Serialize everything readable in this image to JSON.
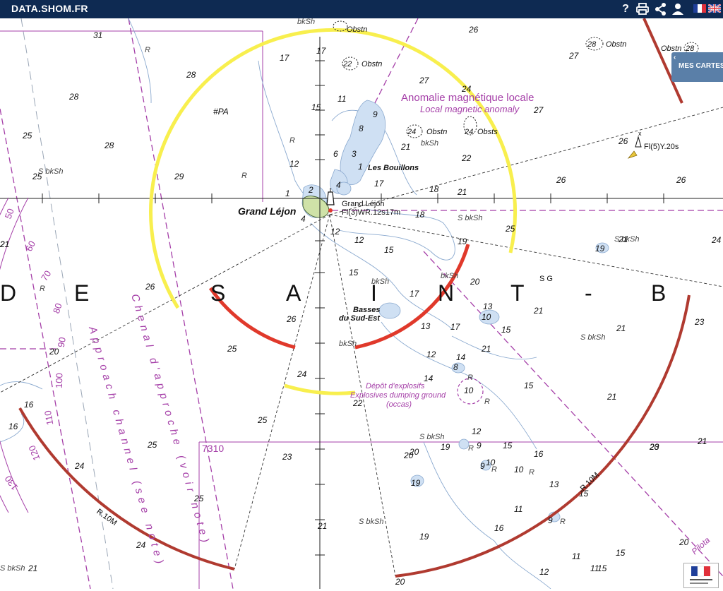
{
  "topbar": {
    "brand": "DATA.SHOM.FR",
    "help": "?"
  },
  "icons": {
    "help": "help-icon",
    "print": "print-icon",
    "share": "share-icon",
    "user": "user-icon",
    "lang_fr": "french-flag-icon",
    "lang_en": "uk-flag-icon"
  },
  "panel": {
    "chevron": "‹",
    "label": "MES CARTES"
  },
  "colors": {
    "topbar": "#0e2a52",
    "sea": "#ffffff",
    "shallow": "#cfe0f3",
    "depth_contour": "#8aa9cf",
    "magenta": "#a53fa8",
    "sector_yellow": "#f8ef4e",
    "sector_red": "#e0392b",
    "range_arc": "#b03a30",
    "land": "#cfe2a8"
  },
  "chart": {
    "big_letters": [
      "D",
      "E",
      "S",
      "A",
      "I",
      "N",
      "T",
      "-",
      "B"
    ],
    "labels": {
      "anomaly_fr": "Anomalie magnétique locale",
      "anomaly_en": "Local magnetic anomaly",
      "les_bouillons": "Les Bouillons",
      "grand_lejon_big": "Grand Léjon",
      "grand_lejon_small": "Grand Léjon",
      "light_char": "Fl(3)WR.12s17m",
      "buoy_char": "Fl(5)Y.20s",
      "basses_1": "Basses",
      "basses_2": "du Sud-Est",
      "depot_1": "Dépôt d'explosifs",
      "depot_2": "Explosives dumping ground",
      "depot_3": "(occas)",
      "chart_no": "7310",
      "pa": "#PA",
      "range_1": "R.10M",
      "range_2": "R.10M",
      "approach_fr": "Chenal d'approche (voir note)",
      "approach_en": "Approach channel (see note)",
      "pilot": "Pilota",
      "sg": "S G"
    },
    "obstructions": [
      {
        "label": "Obstn",
        "num": ""
      },
      {
        "label": "Obstn",
        "num": "22"
      },
      {
        "label": "Obstn",
        "num": "24"
      },
      {
        "label": "Obsts",
        "num": "24"
      },
      {
        "label": "Obstn",
        "num": "28"
      },
      {
        "label": "Obstn",
        "num": "28"
      }
    ],
    "soundings": [
      {
        "v": "31"
      },
      {
        "v": "28"
      },
      {
        "v": "28"
      },
      {
        "v": "28"
      },
      {
        "v": "25"
      },
      {
        "v": "25"
      },
      {
        "v": "29"
      },
      {
        "v": "21"
      },
      {
        "v": "17"
      },
      {
        "v": "17"
      },
      {
        "v": "15"
      },
      {
        "v": "11"
      },
      {
        "v": "12"
      },
      {
        "v": "9"
      },
      {
        "v": "8"
      },
      {
        "v": "6"
      },
      {
        "v": "3"
      },
      {
        "v": "1"
      },
      {
        "v": "4"
      },
      {
        "v": "2"
      },
      {
        "v": "1"
      },
      {
        "v": "4"
      },
      {
        "v": "12"
      },
      {
        "v": "12"
      },
      {
        "v": "15"
      },
      {
        "v": "15"
      },
      {
        "v": "17"
      },
      {
        "v": "18"
      },
      {
        "v": "18"
      },
      {
        "v": "21"
      },
      {
        "v": "22"
      },
      {
        "v": "21"
      },
      {
        "v": "27"
      },
      {
        "v": "24"
      },
      {
        "v": "26"
      },
      {
        "v": "27"
      },
      {
        "v": "27"
      },
      {
        "v": "26"
      },
      {
        "v": "26"
      },
      {
        "v": "26"
      },
      {
        "v": "25"
      },
      {
        "v": "19"
      },
      {
        "v": "19"
      },
      {
        "v": "21"
      },
      {
        "v": "24"
      },
      {
        "v": "20"
      },
      {
        "v": "17"
      },
      {
        "v": "13"
      },
      {
        "v": "10"
      },
      {
        "v": "15"
      },
      {
        "v": "21"
      },
      {
        "v": "23"
      },
      {
        "v": "21"
      },
      {
        "v": "21"
      },
      {
        "v": "13"
      },
      {
        "v": "17"
      },
      {
        "v": "12"
      },
      {
        "v": "14"
      },
      {
        "v": "8"
      },
      {
        "v": "14"
      },
      {
        "v": "15"
      },
      {
        "v": "21"
      },
      {
        "v": "10"
      },
      {
        "v": "26"
      },
      {
        "v": "26"
      },
      {
        "v": "25"
      },
      {
        "v": "24"
      },
      {
        "v": "22"
      },
      {
        "v": "25"
      },
      {
        "v": "25"
      },
      {
        "v": "23"
      },
      {
        "v": "21"
      },
      {
        "v": "16"
      },
      {
        "v": "16"
      },
      {
        "v": "24"
      },
      {
        "v": "25"
      },
      {
        "v": "24"
      },
      {
        "v": "21"
      },
      {
        "v": "20"
      },
      {
        "v": "19"
      },
      {
        "v": "19"
      },
      {
        "v": "9"
      },
      {
        "v": "12"
      },
      {
        "v": "15"
      },
      {
        "v": "16"
      },
      {
        "v": "9"
      },
      {
        "v": "10"
      },
      {
        "v": "13"
      },
      {
        "v": "15"
      },
      {
        "v": "15"
      },
      {
        "v": "23"
      },
      {
        "v": "21"
      },
      {
        "v": "11"
      },
      {
        "v": "9"
      },
      {
        "v": "19"
      },
      {
        "v": "20"
      },
      {
        "v": "21"
      },
      {
        "v": "11"
      },
      {
        "v": "15"
      },
      {
        "v": "20"
      },
      {
        "v": "12"
      },
      {
        "v": "11"
      },
      {
        "v": "20"
      },
      {
        "v": "16"
      },
      {
        "v": "10"
      },
      {
        "v": "20"
      },
      {
        "v": "20"
      },
      {
        "v": "21"
      },
      {
        "v": "23"
      }
    ],
    "seabed": [
      "bkSh",
      "bkSh",
      "S bkSh",
      "bkSh",
      "S bkSh",
      "bkSh",
      "bkSh",
      "S bkSh",
      "S bkSh",
      "S bkSh",
      "S bkSh",
      "S bkSh",
      "R",
      "R",
      "R",
      "R",
      "R",
      "R",
      "R",
      "R",
      "R",
      "R"
    ],
    "scale_ticks": [
      "50",
      "60",
      "70",
      "80",
      "90",
      "100",
      "110",
      "120",
      "130"
    ]
  }
}
